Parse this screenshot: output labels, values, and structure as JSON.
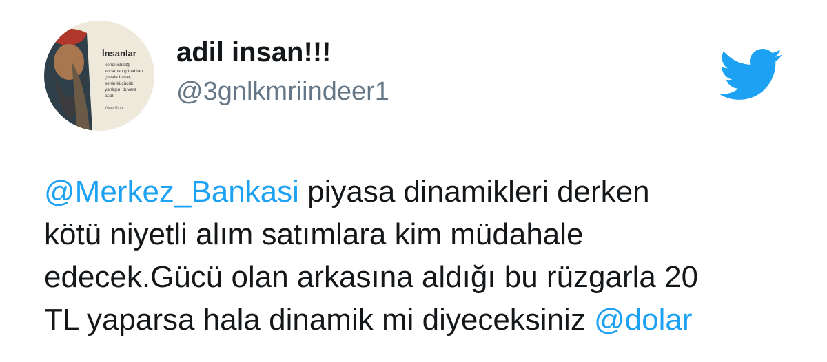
{
  "user": {
    "display_name": "adil insan!!!",
    "handle": "@3gnlkmriindeer1",
    "avatar_text": {
      "title": "İnsanlar",
      "lines": [
        "kendi işlediği",
        "kocaman günahları",
        "çuvala basar,",
        "senin küçücük",
        "yanlışını duvara",
        "asar."
      ],
      "author": "Yunus Emre"
    }
  },
  "tweet": {
    "line1_mention": "@Merkez_Bankasi",
    "line1_text": " piyasa dinamikleri derken",
    "line2_text": "kötü niyetli alım satımlara kim müdahale",
    "line3_text": "edecek.Gücü olan arkasına aldığı bu rüzgarla 20",
    "line4_text": "TL yaparsa hala dinamik mi diyeceksiniz ",
    "line4_mention": "@dolar"
  },
  "colors": {
    "mention": "#1da1f2",
    "text": "#14171a",
    "handle": "#657786",
    "logo": "#1da1f2"
  },
  "icons": {
    "brand": "twitter-bird-icon"
  }
}
